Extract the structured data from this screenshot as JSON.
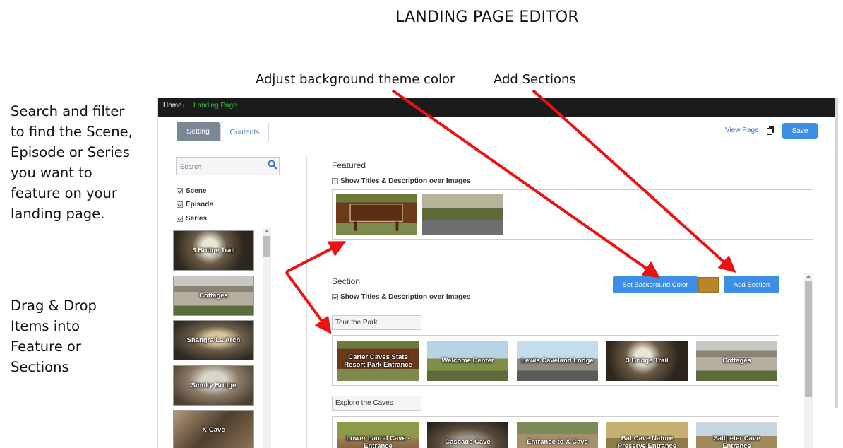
{
  "annotations": {
    "page_title": "LANDING PAGE EDITOR",
    "callout_background": "Adjust background theme color",
    "callout_sections": "Add Sections",
    "note_search": [
      "Search and filter",
      "to find the Scene,",
      "Episode or Series",
      "you want to",
      "feature on your",
      "landing page."
    ],
    "note_drag": [
      "Drag & Drop",
      "Items into",
      "Feature or",
      "Sections"
    ],
    "arrow_color": "#ee1111"
  },
  "breadcrumb": {
    "home": "Home",
    "separator": "›",
    "current": "Landing Page"
  },
  "tabs": {
    "setting": "Setting",
    "contents": "Contents"
  },
  "header": {
    "view_page": "View Page",
    "save": "Save"
  },
  "search": {
    "placeholder": "Search"
  },
  "filters": [
    {
      "label": "Scene",
      "checked": true
    },
    {
      "label": "Episode",
      "checked": true
    },
    {
      "label": "Series",
      "checked": true
    }
  ],
  "left_items": [
    "3 Bridge Trail",
    "Cottages",
    "Shangra La Arch",
    "Smoky Bridge",
    "X-Cave"
  ],
  "featured": {
    "title": "Featured",
    "show_titles_label": "Show Titles & Description over Images",
    "show_titles_checked": false,
    "items": [
      "",
      ""
    ]
  },
  "section": {
    "title": "Section",
    "show_titles_label": "Show Titles & Description over Images",
    "show_titles_checked": true,
    "set_bg_button": "Set Background Color",
    "bg_color": "#b8852a",
    "add_section_button": "Add Section"
  },
  "sections": [
    {
      "name": "Tour the Park",
      "items": [
        "Carter Caves State Resort Park Entrance",
        "Welcome Center",
        "Lewis Caveland Lodge",
        "3 Bridge Trail",
        "Cottages"
      ]
    },
    {
      "name": "Explore the Caves",
      "items": [
        "Lower Laural Cave - Entrance",
        "Cascade Cave",
        "Entrance to X Cave",
        "Bat Cave Nature Preserve Entrance",
        "Saltpeter Cave Entrance"
      ]
    }
  ],
  "colors": {
    "accent": "#3d8ee6",
    "topbar": "#1b1b1b",
    "crumb_active": "#2fbf3f"
  }
}
